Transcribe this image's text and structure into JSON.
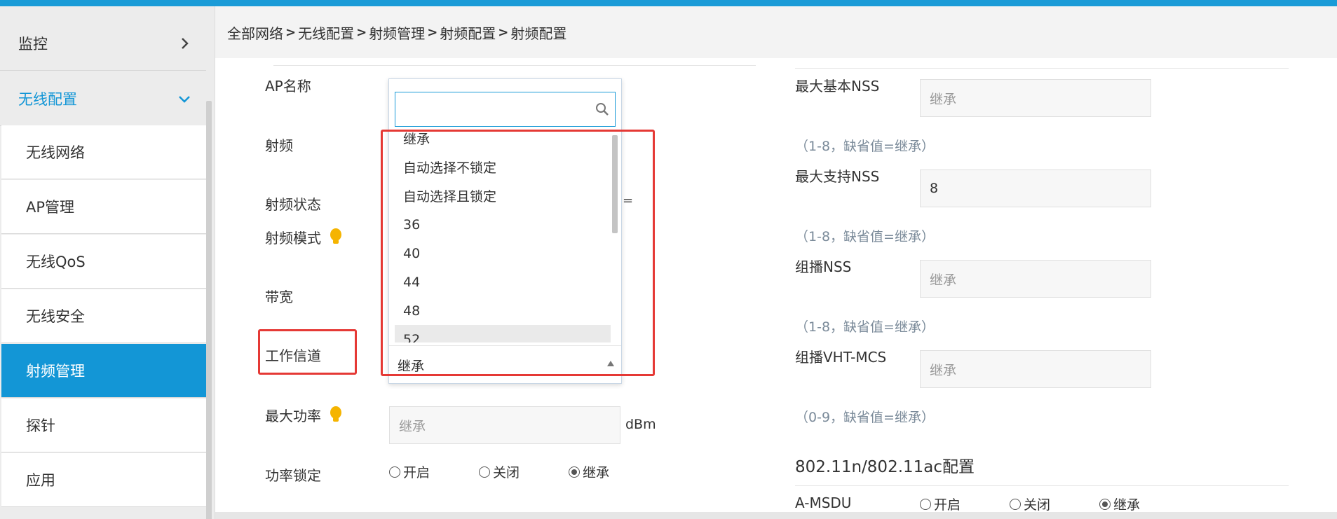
{
  "breadcrumb": [
    "全部网络",
    "无线配置",
    "射频管理",
    "射频配置",
    "射频配置"
  ],
  "sidebar": {
    "monitor": "监控",
    "wireless_config": "无线配置",
    "items": [
      {
        "label": "无线网络"
      },
      {
        "label": "AP管理"
      },
      {
        "label": "无线QoS"
      },
      {
        "label": "无线安全"
      },
      {
        "label": "射频管理"
      },
      {
        "label": "探针"
      },
      {
        "label": "应用"
      }
    ]
  },
  "left_form": {
    "ap_name": "AP名称",
    "radio": "射频",
    "radio_status": "射频状态",
    "radio_mode": "射频模式",
    "bandwidth": "带宽",
    "work_channel": "工作信道",
    "max_power": "最大功率",
    "max_power_placeholder": "继承",
    "max_power_unit": "dBm",
    "power_lock": "功率锁定",
    "radio_open": "开启",
    "radio_close": "关闭",
    "radio_inherit": "继承"
  },
  "dropdown": {
    "options": [
      "继承",
      "自动选择不锁定",
      "自动选择且锁定",
      "36",
      "40",
      "44",
      "48",
      "52"
    ],
    "selected": "继承",
    "partial_char": "="
  },
  "right_form": {
    "max_basic_nss": "最大基本NSS",
    "max_basic_nss_placeholder": "继承",
    "max_basic_nss_hint": "（1-8，缺省值=继承）",
    "max_support_nss": "最大支持NSS",
    "max_support_nss_value": "8",
    "max_support_nss_hint": "（1-8，缺省值=继承）",
    "multicast_nss": "组播NSS",
    "multicast_nss_placeholder": "继承",
    "multicast_nss_hint": "（1-8，缺省值=继承）",
    "multicast_vht_mcs": "组播VHT-MCS",
    "multicast_vht_mcs_placeholder": "继承",
    "multicast_vht_mcs_hint": "（0-9，缺省值=继承）",
    "section_80211": "802.11n/802.11ac配置",
    "amsdu": "A-MSDU",
    "radio_open": "开启",
    "radio_close": "关闭",
    "radio_inherit": "继承"
  },
  "colors": {
    "accent": "#1396d6",
    "highlight_box": "#e53935",
    "bulb": "#f5b400"
  }
}
